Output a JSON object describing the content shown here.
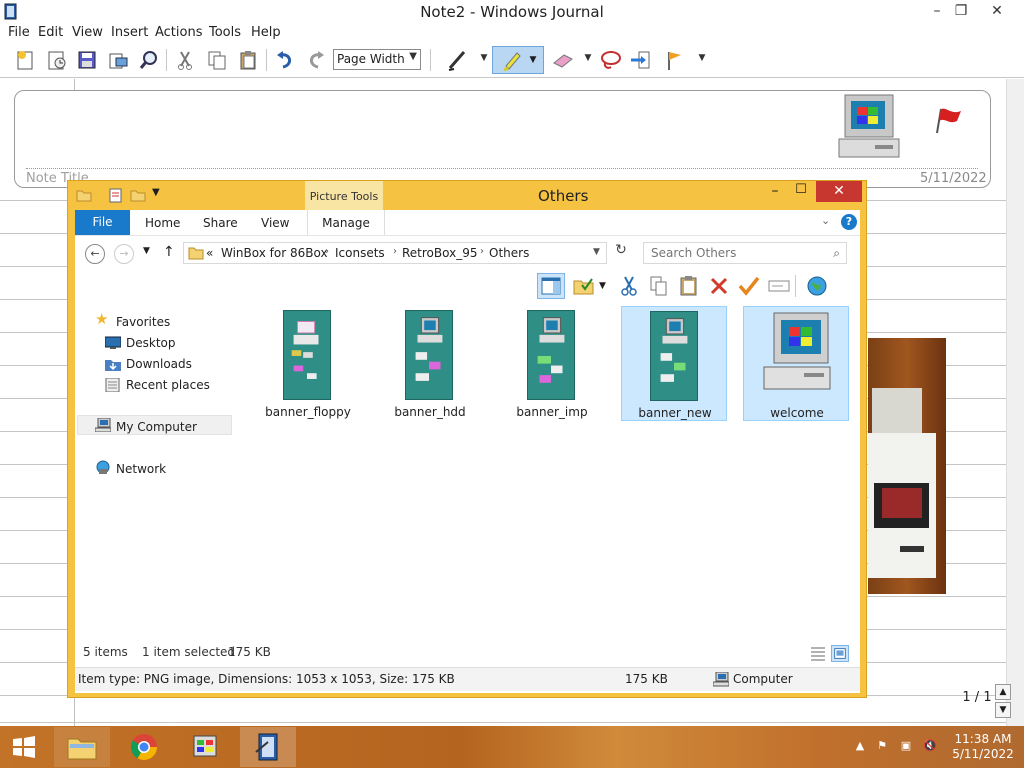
{
  "journal": {
    "title": "Note2 - Windows Journal",
    "window_controls": {
      "minimize": "–",
      "maximize": "❐",
      "close": "✕"
    },
    "menu": [
      "File",
      "Edit",
      "View",
      "Insert",
      "Actions",
      "Tools",
      "Help"
    ],
    "zoom": {
      "value": "Page Width"
    },
    "note": {
      "title_placeholder": "Note Title",
      "date": "5/11/2022"
    },
    "page": {
      "indicator": "1 / 1"
    }
  },
  "explorer": {
    "title": "Others",
    "contextual_tab_group": "Picture Tools",
    "tabs": {
      "file": "File",
      "home": "Home",
      "share": "Share",
      "view": "View",
      "manage": "Manage"
    },
    "address": {
      "overflow": "«",
      "segments": [
        "WinBox for 86Box",
        "Iconsets",
        "RetroBox_95",
        "Others"
      ]
    },
    "search": {
      "placeholder": "Search Others"
    },
    "nav": {
      "favorites": "Favorites",
      "desktop": "Desktop",
      "downloads": "Downloads",
      "recent": "Recent places",
      "computer": "My Computer",
      "network": "Network"
    },
    "files": [
      {
        "name": "banner_floppy",
        "selected": false
      },
      {
        "name": "banner_hdd",
        "selected": false
      },
      {
        "name": "banner_imp",
        "selected": false
      },
      {
        "name": "banner_new",
        "selected": true
      },
      {
        "name": "welcome",
        "selected": true
      }
    ],
    "status": {
      "count": "5 items",
      "selected": "1 item selected",
      "size": "175 KB"
    },
    "details": {
      "info": "Item type: PNG image, Dimensions: 1053 x 1053, Size: 175 KB",
      "size": "175 KB",
      "location": "Computer"
    }
  },
  "taskbar": {
    "time": "11:38 AM",
    "date": "5/11/2022",
    "apps": [
      "file-explorer-icon",
      "chrome-icon",
      "control-panel-icon",
      "windows-journal-icon"
    ]
  },
  "colors": {
    "explorer_frame": "#f5c242",
    "file_tab": "#1979ca",
    "selection": "#cce8ff",
    "close_button": "#c7372f",
    "taskbar": "#c27327"
  }
}
